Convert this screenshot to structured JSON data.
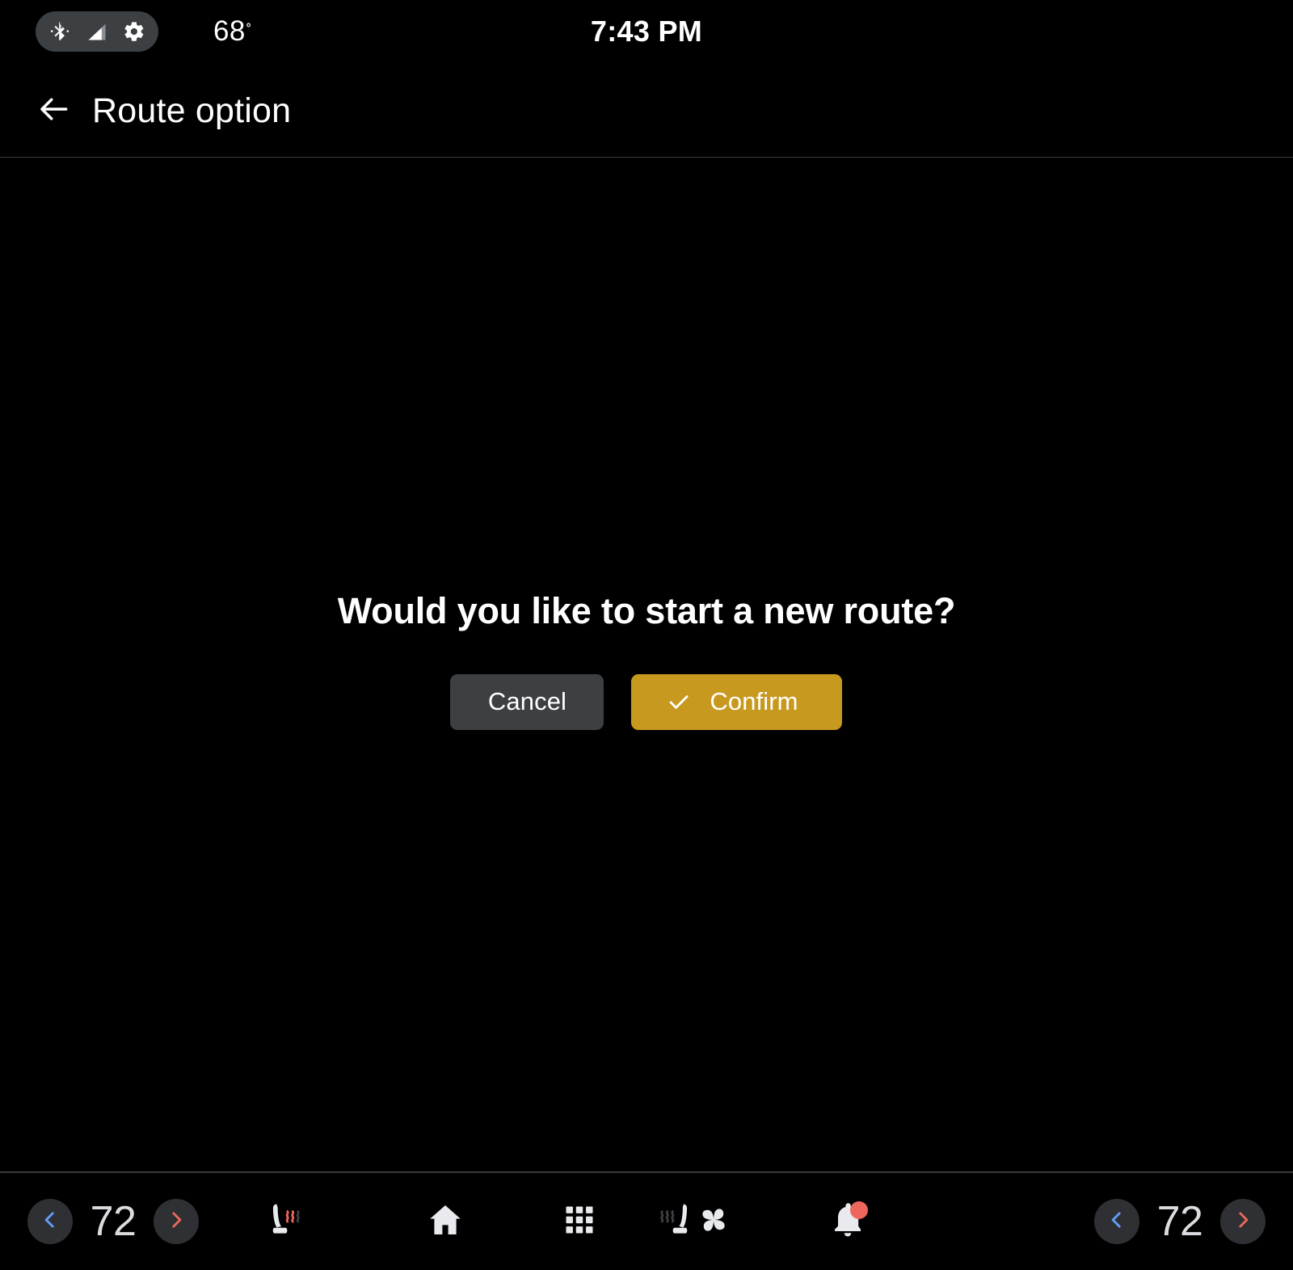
{
  "status_bar": {
    "icons": [
      "bluetooth-icon",
      "signal-icon",
      "gear-icon"
    ],
    "exterior_temp": "68",
    "degree_symbol": "˚",
    "clock": "7:43 PM"
  },
  "app_bar": {
    "back_icon": "back-arrow-icon",
    "title": "Route option"
  },
  "dialog": {
    "message": "Would you like to start a new route?",
    "cancel_label": "Cancel",
    "confirm_label": "Confirm",
    "confirm_icon": "check-icon",
    "cancel_bg": "#3c4043",
    "confirm_bg": "#c8991f"
  },
  "nav_bar": {
    "left_climate": {
      "decrease_icon": "chevron-left-icon",
      "temperature": "72",
      "increase_icon": "chevron-right-icon",
      "decrease_color": "#669df6",
      "increase_color": "#ee675c"
    },
    "left_seat_heater": {
      "icon": "seat-heater-left-icon",
      "active_color": "#ee675c"
    },
    "center_items": [
      {
        "icon": "home-icon",
        "label": "Home"
      },
      {
        "icon": "apps-grid-icon",
        "label": "Apps"
      },
      {
        "icon": "fan-icon",
        "label": "Climate"
      },
      {
        "icon": "bell-icon",
        "label": "Notifications",
        "badge": true
      }
    ],
    "right_seat_heater": {
      "icon": "seat-heater-right-icon"
    },
    "right_climate": {
      "decrease_icon": "chevron-left-icon",
      "temperature": "72",
      "increase_icon": "chevron-right-icon",
      "decrease_color": "#669df6",
      "increase_color": "#ee675c"
    }
  }
}
